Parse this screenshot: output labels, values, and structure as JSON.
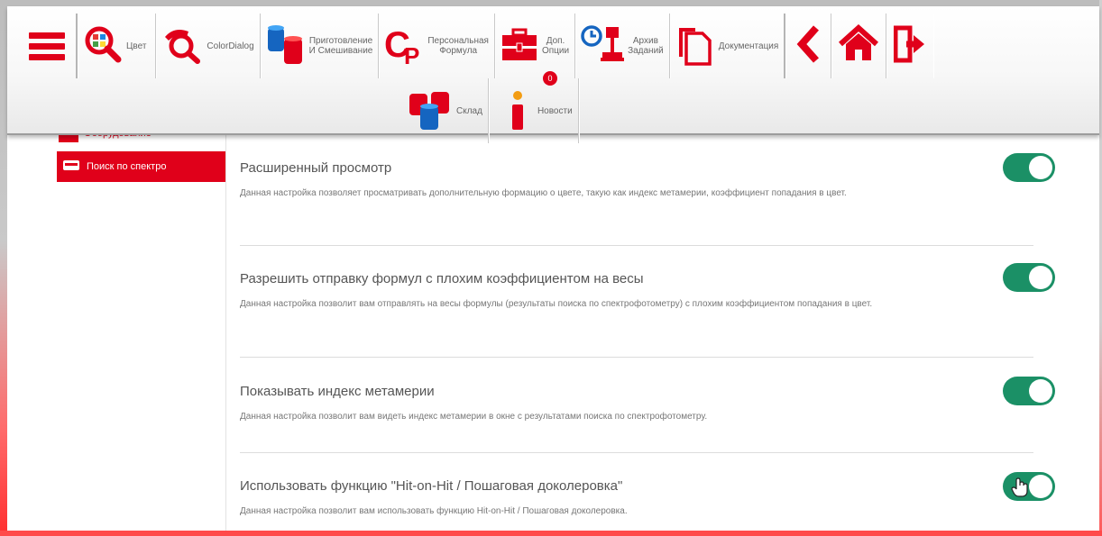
{
  "toolbar": {
    "items": [
      {
        "label": "",
        "icon": "hamburger-menu-icon"
      },
      {
        "label": "Цвет",
        "icon": "color-search-icon"
      },
      {
        "label": "ColorDialog",
        "icon": "color-dialog-icon"
      },
      {
        "label": "Приготовление\nИ Смешивание",
        "icon": "mixing-cans-icon"
      },
      {
        "label": "Персональная\nФормула",
        "icon": "cp-formula-icon"
      },
      {
        "label": "Доп.\nОпции",
        "icon": "toolbox-icon"
      },
      {
        "label": "Архив\nЗаданий",
        "icon": "job-archive-icon"
      },
      {
        "label": "Документация",
        "icon": "documents-icon"
      },
      {
        "label": "",
        "icon": "back-arrow-icon"
      },
      {
        "label": "",
        "icon": "home-icon"
      },
      {
        "label": "",
        "icon": "logout-icon"
      }
    ],
    "row2": [
      {
        "label": "Склад",
        "icon": "warehouse-icon"
      },
      {
        "label": "Новости",
        "icon": "news-info-icon",
        "badge": "0"
      }
    ]
  },
  "sidebar": {
    "partial_item": "Оборудование",
    "active_item": "Поиск по спектро"
  },
  "settings": [
    {
      "title": "Расширенный просмотр",
      "description": "Данная настройка позволяет просматривать дополнительную формацию о цвете, такую как индекс метамерии, коэффициент попадания в цвет.",
      "enabled": true
    },
    {
      "title": "Разрешить отправку формул с плохим коэффициентом на весы",
      "description": "Данная настройка позволит вам отправлять на весы формулы (результаты поиска по спектрофотометру) с плохим коэффициентом попадания в цвет.",
      "enabled": true
    },
    {
      "title": "Показывать индекс метамерии",
      "description": "Данная настройка позволит вам видеть индекс метамерии в окне с результатами поиска по спектрофотометру.",
      "enabled": true
    },
    {
      "title": "Использовать функцию \"Hit-on-Hit / Пошаговая доколеровка\"",
      "description": "Данная настройка позволит вам использовать функцию Hit-on-Hit / Пошаговая доколеровка.",
      "enabled": true
    }
  ],
  "colors": {
    "accent_red": "#e0001a",
    "toggle_green": "#1b9066"
  }
}
